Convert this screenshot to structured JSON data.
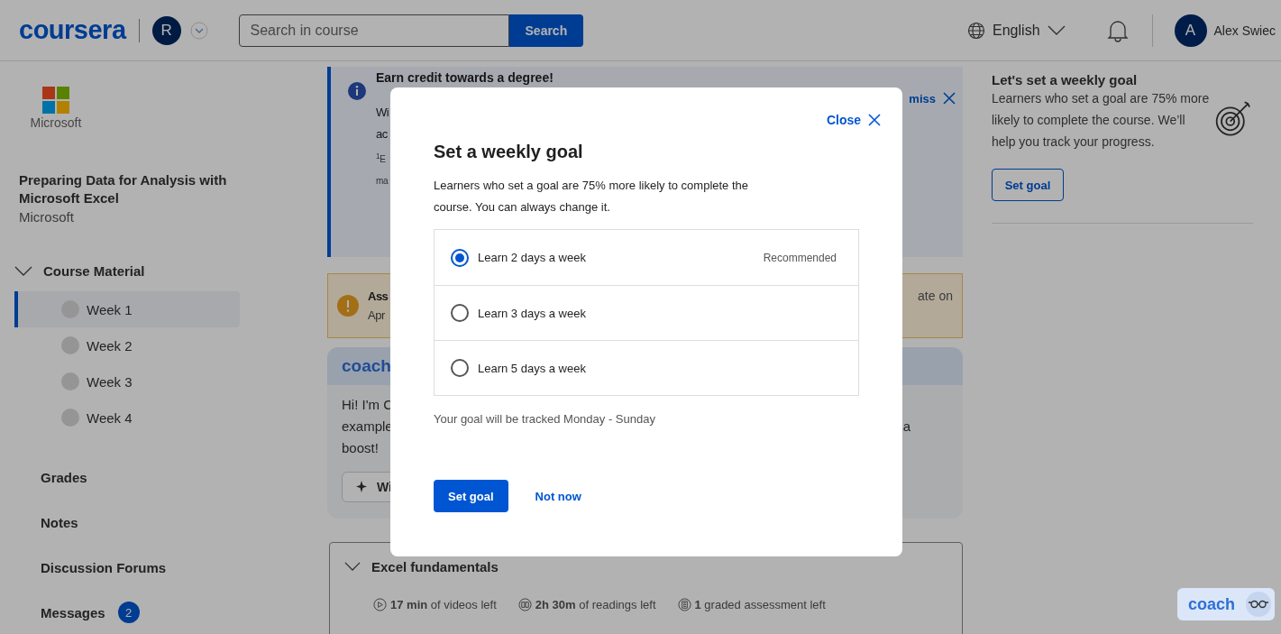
{
  "header": {
    "logo": "coursera",
    "partner_initial": "R",
    "search": {
      "placeholder": "Search in course",
      "button": "Search"
    },
    "language": "English",
    "user": {
      "initial": "A",
      "name": "Alex Swiec"
    }
  },
  "sidebar": {
    "partner_logo": "Microsoft",
    "course_title": "Preparing Data for Analysis with Microsoft Excel",
    "course_partner": "Microsoft",
    "section": {
      "label": "Course Material",
      "expanded": true,
      "items": [
        {
          "label": "Week 1",
          "selected": true
        },
        {
          "label": "Week 2",
          "selected": false
        },
        {
          "label": "Week 3",
          "selected": false
        },
        {
          "label": "Week 4",
          "selected": false
        }
      ]
    },
    "links": [
      {
        "label": "Grades"
      },
      {
        "label": "Notes"
      },
      {
        "label": "Discussion Forums"
      },
      {
        "label": "Messages",
        "badge": "2"
      }
    ]
  },
  "main": {
    "info_banner": {
      "title": "Earn credit towards a degree!",
      "lines": [
        "Wi",
        "ac",
        "$^{1}$E",
        "ma"
      ],
      "dismiss": "miss"
    },
    "warning_banner": {
      "title": "Ass",
      "text": "Apr",
      "right_text": "ate on"
    },
    "coach_card": {
      "logo": "coach",
      "lines": [
        "Hi! I'm C",
        "example",
        "boost!"
      ],
      "right_text": "a",
      "button": "Wi"
    },
    "module": {
      "title": "Excel fundamentals",
      "expanded": true,
      "stats": [
        {
          "kind": "video",
          "text": "**17 min** of videos left"
        },
        {
          "kind": "reading",
          "text": "**2h 30m** of readings left"
        },
        {
          "kind": "assessment",
          "text": "**1** graded assessment left"
        }
      ]
    }
  },
  "goal_panel": {
    "title": "Let's set a weekly goal",
    "text": "Learners who set a goal are 75% more likely to complete the course. We’ll help you track your progress.",
    "button": "Set goal"
  },
  "coach_button": {
    "label": "coach"
  },
  "modal": {
    "close": "Close",
    "title": "Set a weekly goal",
    "description": "Learners who set a goal are 75% more likely to complete the course. You can always change it.",
    "options": [
      {
        "label": "Learn 2 days a week",
        "selected": true,
        "tag": "Recommended"
      },
      {
        "label": "Learn 3 days a week",
        "selected": false
      },
      {
        "label": "Learn 5 days a week",
        "selected": false
      }
    ],
    "note": "Your goal will be tracked Monday - Sunday",
    "primary": "Set goal",
    "secondary": "Not now"
  }
}
